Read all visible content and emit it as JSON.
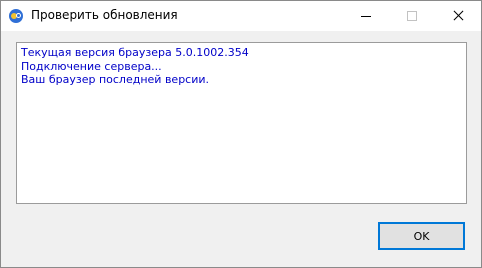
{
  "window": {
    "title": "Проверить обновления",
    "icon": "browser-logo-icon"
  },
  "log": {
    "lines": [
      "Текущая версия браузера 5.0.1002.354",
      "Подключение сервера...",
      "Ваш браузер последней версии."
    ],
    "text_color": "#0000c8"
  },
  "buttons": {
    "ok_label": "OK"
  },
  "colors": {
    "accent": "#0078d7"
  }
}
